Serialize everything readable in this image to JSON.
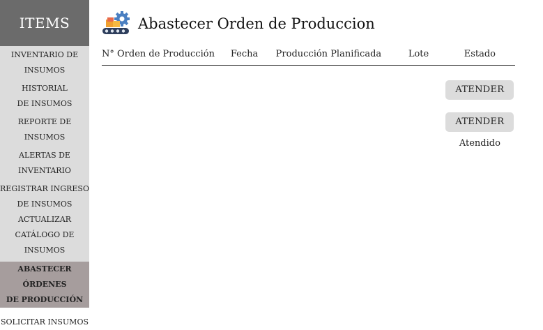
{
  "sidebar": {
    "header": "ITEMS",
    "items": [
      {
        "line1": "INVENTARIO DE",
        "line2": "INSUMOS"
      },
      {
        "line1": "HISTORIAL",
        "line2": "DE INSUMOS"
      },
      {
        "line1": "REPORTE DE",
        "line2": "INSUMOS"
      },
      {
        "line1": "ALERTAS DE",
        "line2": "INVENTARIO"
      },
      {
        "line1": "REGISTRAR INGRESO",
        "line2": "DE INSUMOS"
      },
      {
        "line1": "ACTUALIZAR",
        "line2": "CATÁLOGO DE INSUMOS"
      },
      {
        "line1": "ABASTECER ÓRDENES",
        "line2": "DE PRODUCCIÓN"
      },
      {
        "line1": "SOLICITAR INSUMOS",
        "line2": ""
      }
    ]
  },
  "page": {
    "title": "Abastecer Orden de Produccion",
    "icon": "conveyor-gear-icon"
  },
  "table": {
    "headers": [
      "N° Orden de Producción",
      "Fecha",
      "Producción Planificada",
      "Lote",
      "Estado"
    ],
    "rows": [
      {
        "estado": "ATENDER"
      },
      {
        "estado": "ATENDER"
      },
      {
        "estado": "Atendido"
      }
    ]
  }
}
